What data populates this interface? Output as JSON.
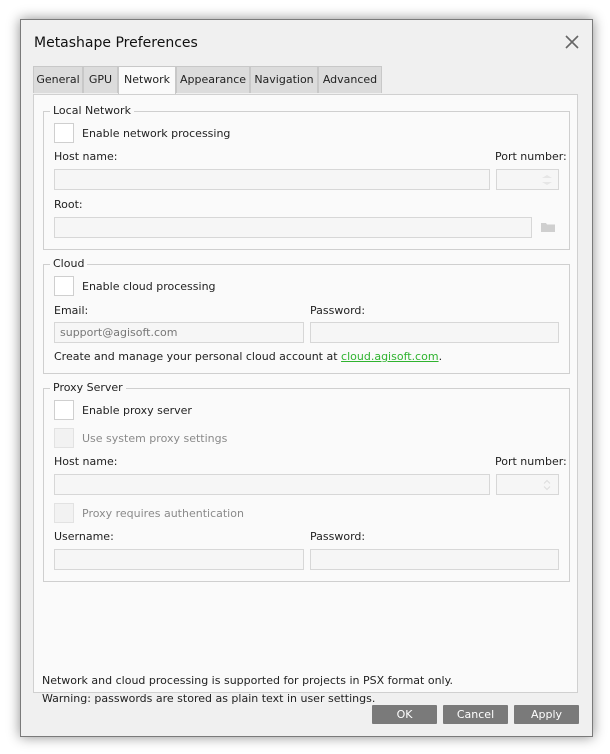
{
  "window": {
    "title": "Metashape Preferences"
  },
  "tabs": [
    {
      "label": "General"
    },
    {
      "label": "GPU"
    },
    {
      "label": "Network"
    },
    {
      "label": "Appearance"
    },
    {
      "label": "Navigation"
    },
    {
      "label": "Advanced"
    }
  ],
  "active_tab": "Network",
  "local_network": {
    "legend": "Local Network",
    "enable_label": "Enable network processing",
    "host_label": "Host name:",
    "host_value": "",
    "port_label": "Port number:",
    "port_value": "",
    "root_label": "Root:",
    "root_value": ""
  },
  "cloud": {
    "legend": "Cloud",
    "enable_label": "Enable cloud processing",
    "email_label": "Email:",
    "email_placeholder": "support@agisoft.com",
    "password_label": "Password:",
    "password_value": "",
    "info_text": "Create and manage your personal cloud account at ",
    "link_text": "cloud.agisoft.com",
    "info_end": "."
  },
  "proxy": {
    "legend": "Proxy Server",
    "enable_label": "Enable proxy server",
    "system_label": "Use system proxy settings",
    "host_label": "Host name:",
    "host_value": "",
    "port_label": "Port number:",
    "port_value": "",
    "auth_label": "Proxy requires authentication",
    "username_label": "Username:",
    "username_value": "",
    "password_label": "Password:",
    "password_value": ""
  },
  "notes": {
    "line1": "Network and cloud processing is supported for projects in PSX format only.",
    "line2": "Warning: passwords are stored as plain text in user settings."
  },
  "buttons": {
    "ok": "OK",
    "cancel": "Cancel",
    "apply": "Apply"
  },
  "colors": {
    "button_bg": "#7a7a7a",
    "link": "#2fb32f",
    "pane_bg": "#fafafa"
  }
}
